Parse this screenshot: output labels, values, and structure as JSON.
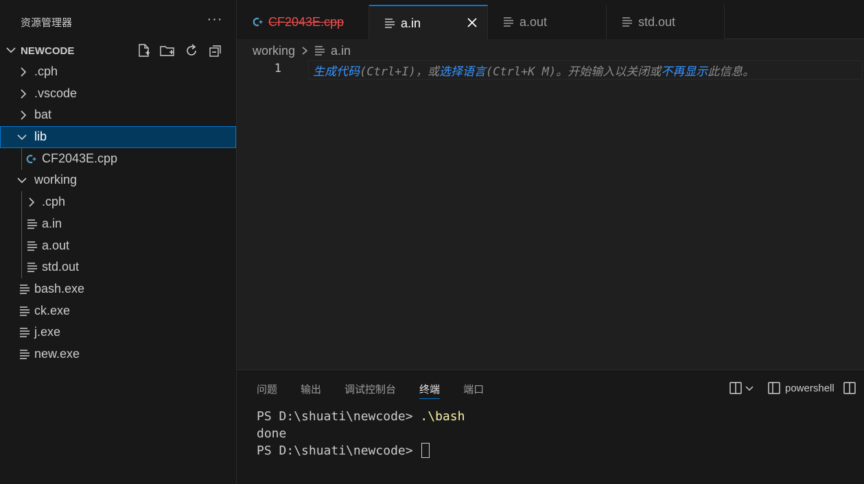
{
  "explorer": {
    "title": "资源管理器",
    "more": "···",
    "section": "NEWCODE"
  },
  "tree": [
    {
      "label": ".cph",
      "type": "folder",
      "expanded": false,
      "depth": 0
    },
    {
      "label": ".vscode",
      "type": "folder",
      "expanded": false,
      "depth": 0
    },
    {
      "label": "bat",
      "type": "folder",
      "expanded": false,
      "depth": 0
    },
    {
      "label": "lib",
      "type": "folder",
      "expanded": true,
      "depth": 0,
      "selected": true
    },
    {
      "label": "CF2043E.cpp",
      "type": "cpp",
      "depth": 1
    },
    {
      "label": "working",
      "type": "folder",
      "expanded": true,
      "depth": 0
    },
    {
      "label": ".cph",
      "type": "folder",
      "expanded": false,
      "depth": 1
    },
    {
      "label": "a.in",
      "type": "file",
      "depth": 1
    },
    {
      "label": "a.out",
      "type": "file",
      "depth": 1
    },
    {
      "label": "std.out",
      "type": "file",
      "depth": 1
    },
    {
      "label": "bash.exe",
      "type": "file",
      "depth": 0
    },
    {
      "label": "ck.exe",
      "type": "file",
      "depth": 0
    },
    {
      "label": "j.exe",
      "type": "file",
      "depth": 0
    },
    {
      "label": "new.exe",
      "type": "file",
      "depth": 0
    }
  ],
  "tabs": [
    {
      "label": "CF2043E.cpp",
      "icon": "cpp-icon",
      "error": true
    },
    {
      "label": "a.in",
      "icon": "file-icon",
      "active": true
    },
    {
      "label": "a.out",
      "icon": "file-icon"
    },
    {
      "label": "std.out",
      "icon": "file-icon"
    }
  ],
  "breadcrumb": {
    "folder": "working",
    "file": "a.in"
  },
  "editor": {
    "line_number": "1",
    "hint": {
      "p1": "生成代码",
      "p2": "(Ctrl+I)，或",
      "p3": "选择语言",
      "p4": "(Ctrl+K M)。开始输入以关闭或",
      "p5": "不再显示",
      "p6": "此信息。"
    }
  },
  "panel": {
    "tabs": [
      "问题",
      "输出",
      "调试控制台",
      "终端",
      "端口"
    ],
    "active_tab": "终端",
    "shell": "powershell"
  },
  "terminal": {
    "l1_prompt": "PS D:\\shuati\\newcode> ",
    "l1_cmd": ".\\bash",
    "l2": "done",
    "l3_prompt": "PS D:\\shuati\\newcode> "
  },
  "colors": {
    "accent": "#0078d4",
    "selection": "#04395e",
    "error_tab": "#f14c4c",
    "link": "#3794ff",
    "command": "#f9f1a5"
  }
}
